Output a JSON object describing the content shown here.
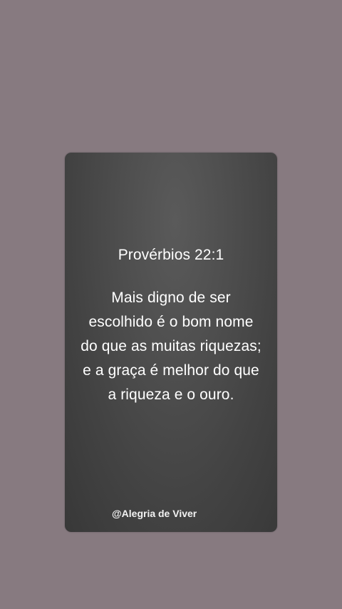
{
  "colors": {
    "background": "#877a80",
    "card": "#4a4a4a",
    "text": "#ffffff"
  },
  "card": {
    "reference": "Provérbios 22:1",
    "verse_lines": [
      "Mais digno de ser",
      "escolhido é o bom nome",
      "do que as muitas riquezas;",
      "e a graça é melhor do que",
      "a riqueza e o ouro."
    ],
    "signature": "@Alegria de Viver"
  }
}
